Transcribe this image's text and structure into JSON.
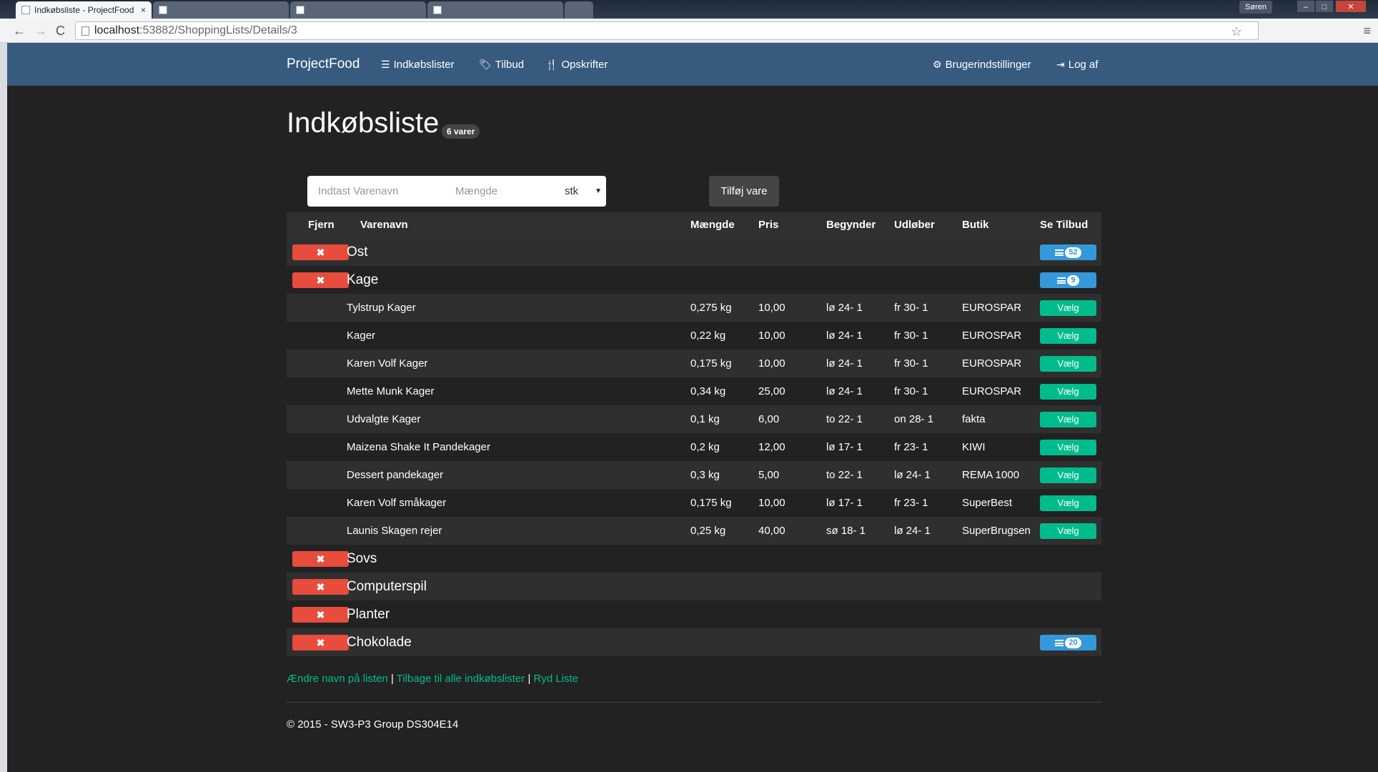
{
  "browser": {
    "tabs": [
      {
        "title": "Indkøbsliste - ProjectFood",
        "active": true
      },
      {
        "title": "",
        "active": false
      },
      {
        "title": "",
        "active": false
      },
      {
        "title": "",
        "active": false
      },
      {
        "title": "",
        "active": false
      }
    ],
    "tab_close": "×",
    "user": "Søren",
    "window_controls": [
      "–",
      "□",
      "✕"
    ],
    "back": "←",
    "forward": "→",
    "reload": "C",
    "url_host": "localhost",
    "url_rest": ":53882/ShoppingLists/Details/3",
    "star": "☆",
    "menu": "≡"
  },
  "navbar": {
    "brand": "ProjectFood",
    "links": [
      {
        "label": "Indkøbslister",
        "icon": "list-icon",
        "glyph": "☰"
      },
      {
        "label": "Tilbud",
        "icon": "tags-icon",
        "glyph": "🏷"
      },
      {
        "label": "Opskrifter",
        "icon": "cutlery-icon",
        "glyph": "🍴"
      }
    ],
    "right_links": [
      {
        "label": "Brugerindstillinger",
        "icon": "gear-icon",
        "glyph": "⚙"
      },
      {
        "label": "Log af",
        "icon": "logout-icon",
        "glyph": "⇥"
      }
    ]
  },
  "page": {
    "title": "Indkøbsliste",
    "count_badge": "6 varer"
  },
  "form": {
    "name_placeholder": "Indtast Varenavn",
    "amount_placeholder": "Mængde",
    "unit": "stk",
    "unit_arrow": "▼",
    "submit": "Tilføj vare"
  },
  "table": {
    "headers": [
      "Fjern",
      "Varenavn",
      "Mængde",
      "Pris",
      "Begynder",
      "Udløber",
      "Butik",
      "Se Tilbud"
    ],
    "remove_glyph": "✖",
    "choose_label": "Vælg",
    "rows": [
      {
        "kind": "item",
        "name": "Ost",
        "offers": "52"
      },
      {
        "kind": "item",
        "name": "Kage",
        "offers": "9"
      },
      {
        "kind": "offer",
        "name": "Tylstrup Kager",
        "amount": "0,275 kg",
        "price": "10,00",
        "start": "lø 24- 1",
        "end": "fr 30- 1",
        "store": "EUROSPAR"
      },
      {
        "kind": "offer",
        "name": "Kager",
        "amount": "0,22 kg",
        "price": "10,00",
        "start": "lø 24- 1",
        "end": "fr 30- 1",
        "store": "EUROSPAR"
      },
      {
        "kind": "offer",
        "name": "Karen Volf Kager",
        "amount": "0,175 kg",
        "price": "10,00",
        "start": "lø 24- 1",
        "end": "fr 30- 1",
        "store": "EUROSPAR"
      },
      {
        "kind": "offer",
        "name": "Mette Munk Kager",
        "amount": "0,34 kg",
        "price": "25,00",
        "start": "lø 24- 1",
        "end": "fr 30- 1",
        "store": "EUROSPAR"
      },
      {
        "kind": "offer",
        "name": "Udvalgte Kager",
        "amount": "0,1 kg",
        "price": "6,00",
        "start": "to 22- 1",
        "end": "on 28- 1",
        "store": "fakta"
      },
      {
        "kind": "offer",
        "name": "Maizena Shake It Pandekager",
        "amount": "0,2 kg",
        "price": "12,00",
        "start": "lø 17- 1",
        "end": "fr 23- 1",
        "store": "KIWI"
      },
      {
        "kind": "offer",
        "name": "Dessert pandekager",
        "amount": "0,3 kg",
        "price": "5,00",
        "start": "to 22- 1",
        "end": "lø 24- 1",
        "store": "REMA 1000"
      },
      {
        "kind": "offer",
        "name": "Karen Volf småkager",
        "amount": "0,175 kg",
        "price": "10,00",
        "start": "lø 17- 1",
        "end": "fr 23- 1",
        "store": "SuperBest"
      },
      {
        "kind": "offer",
        "name": "Launis Skagen rejer",
        "amount": "0,25 kg",
        "price": "40,00",
        "start": "sø 18- 1",
        "end": "lø 24- 1",
        "store": "SuperBrugsen"
      },
      {
        "kind": "item",
        "name": "Sovs",
        "offers": null
      },
      {
        "kind": "item",
        "name": "Computerspil",
        "offers": null
      },
      {
        "kind": "item",
        "name": "Planter",
        "offers": null
      },
      {
        "kind": "item",
        "name": "Chokolade",
        "offers": "20"
      }
    ]
  },
  "links": {
    "rename": "Ændre navn på listen",
    "back": "Tilbage til alle indkøbslister",
    "clear": "Ryd Liste",
    "separator": "|"
  },
  "footer": "© 2015 - SW3-P3 Group DS304E14",
  "colors": {
    "navbar": "#375a7f",
    "danger": "#e74c3c",
    "info": "#3498db",
    "success": "#00bc8c",
    "background": "#222222"
  }
}
